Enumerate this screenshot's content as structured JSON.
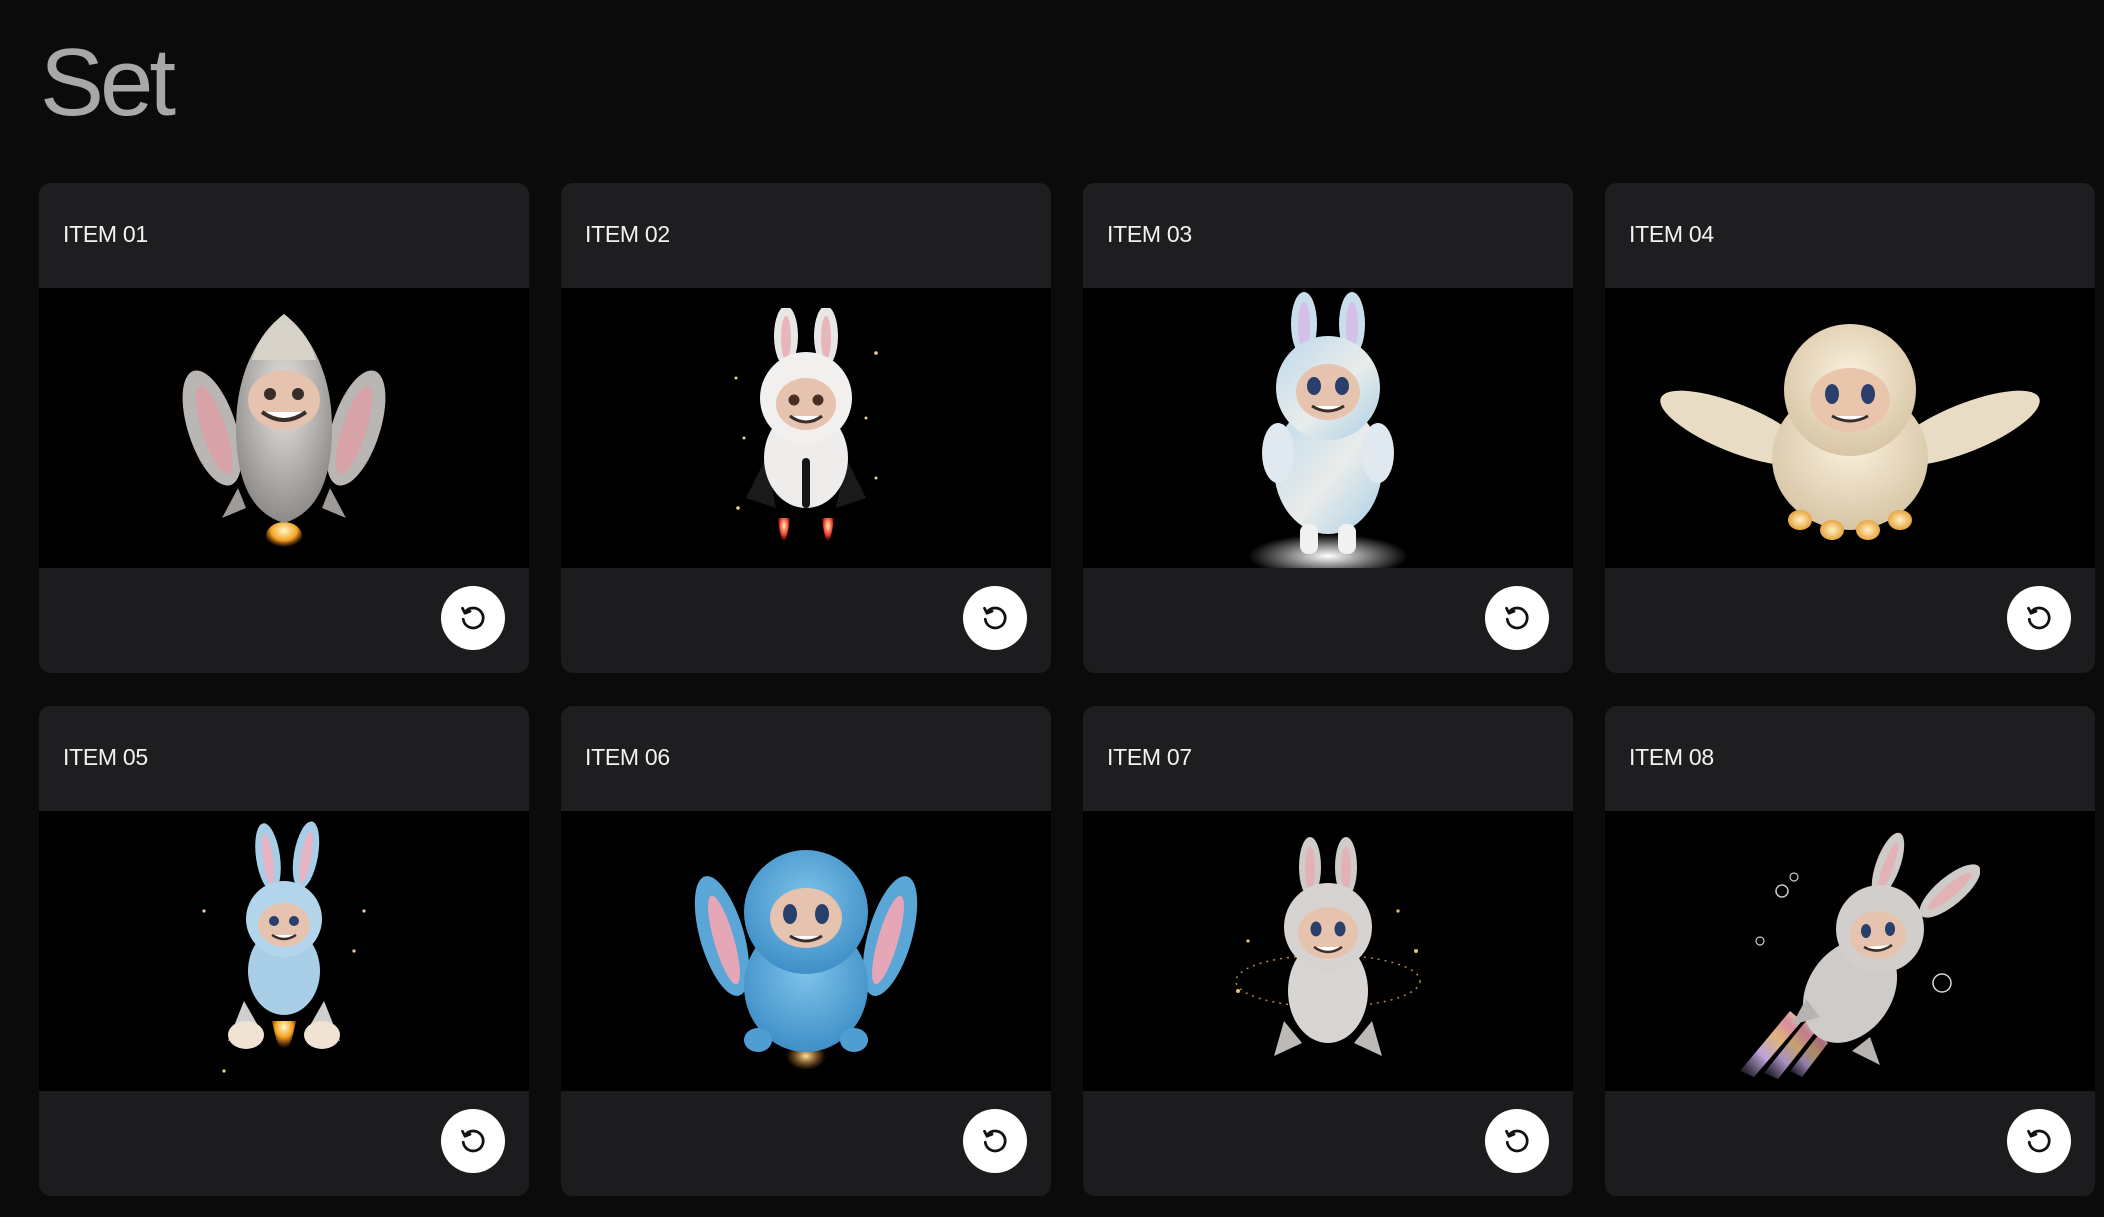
{
  "page": {
    "title": "Set"
  },
  "colors": {
    "background": "#0b0b0c",
    "card": "#1c1c1e",
    "media": "#000000",
    "title": "#a8a8a8",
    "label": "#f2f2f2",
    "button": "#ffffff"
  },
  "items": [
    {
      "label": "ITEM 01",
      "figure": "grey-bunny-rocket-toy",
      "action_icon": "replay-icon"
    },
    {
      "label": "ITEM 02",
      "figure": "white-bunny-black-rocket-toy",
      "action_icon": "replay-icon"
    },
    {
      "label": "ITEM 03",
      "figure": "pastel-blue-bunny-toy",
      "action_icon": "replay-icon"
    },
    {
      "label": "ITEM 04",
      "figure": "cream-floppy-ear-toy",
      "action_icon": "replay-icon"
    },
    {
      "label": "ITEM 05",
      "figure": "light-blue-bunny-rocket-toy",
      "action_icon": "replay-icon"
    },
    {
      "label": "ITEM 06",
      "figure": "blue-floppy-ear-toy",
      "action_icon": "replay-icon"
    },
    {
      "label": "ITEM 07",
      "figure": "grey-bunny-sparkle-toy",
      "action_icon": "replay-icon"
    },
    {
      "label": "ITEM 08",
      "figure": "grey-bunny-rainbow-rocket-toy",
      "action_icon": "replay-icon"
    }
  ]
}
